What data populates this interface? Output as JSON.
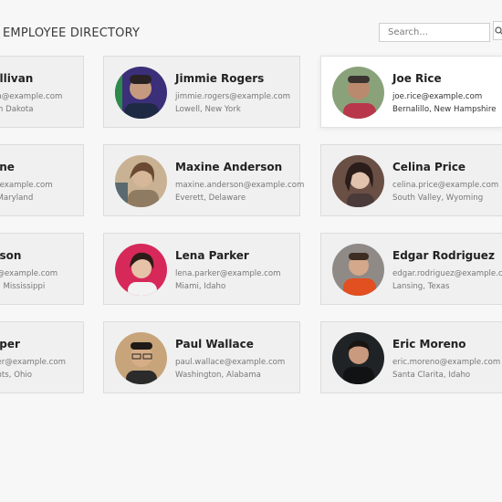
{
  "header": {
    "title": "EMPLOYEE DIRECTORY"
  },
  "search": {
    "placeholder": "Search...",
    "icon": "search-icon"
  },
  "employees": [
    {
      "name": "ullivan",
      "email": "an@example.com",
      "location": "rth Dakota"
    },
    {
      "name": "Jimmie Rogers",
      "email": "jimmie.rogers@example.com",
      "location": "Lowell, New York"
    },
    {
      "name": "Joe Rice",
      "email": "joe.rice@example.com",
      "location": "Bernalillo, New Hampshire"
    },
    {
      "name": "one",
      "email": "@example.com",
      "location": ", Maryland"
    },
    {
      "name": "Maxine Anderson",
      "email": "maxine.anderson@example.com",
      "location": "Everett, Delaware"
    },
    {
      "name": "Celina Price",
      "email": "celina.price@example.com",
      "location": "South Valley, Wyoming"
    },
    {
      "name": "nson",
      "email": "n@example.com",
      "location": "w, Mississippi"
    },
    {
      "name": "Lena Parker",
      "email": "lena.parker@example.com",
      "location": "Miami, Idaho"
    },
    {
      "name": "Edgar Rodriguez",
      "email": "edgar.rodriguez@example.com",
      "location": "Lansing, Texas"
    },
    {
      "name": "oper",
      "email": "per@example.com",
      "location": "ghts, Ohio"
    },
    {
      "name": "Paul Wallace",
      "email": "paul.wallace@example.com",
      "location": "Washington, Alabama"
    },
    {
      "name": "Eric Moreno",
      "email": "eric.moreno@example.com",
      "location": "Santa Clarita, Idaho"
    }
  ]
}
